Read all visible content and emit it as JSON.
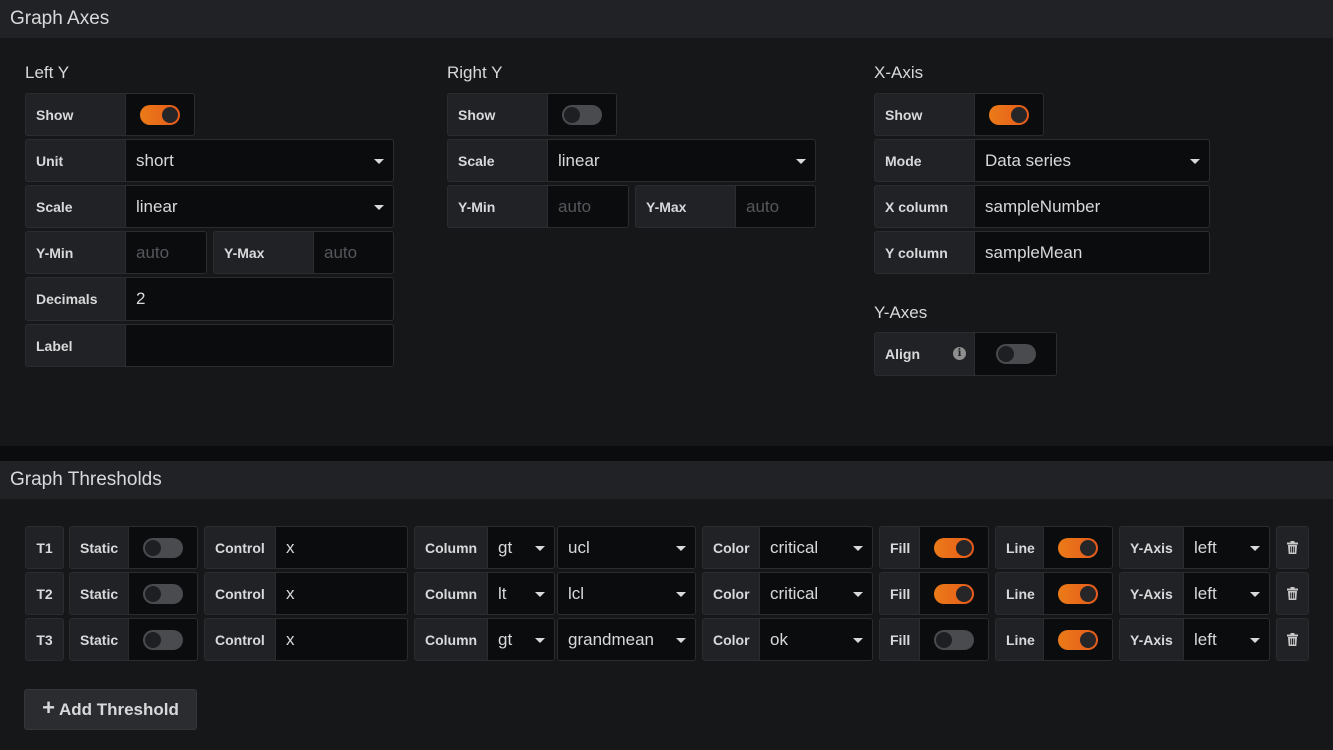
{
  "axes": {
    "title": "Graph Axes",
    "left_y": {
      "title": "Left Y",
      "show_label": "Show",
      "show": true,
      "unit_label": "Unit",
      "unit": "short",
      "scale_label": "Scale",
      "scale": "linear",
      "ymin_label": "Y-Min",
      "ymin_placeholder": "auto",
      "ymax_label": "Y-Max",
      "ymax_placeholder": "auto",
      "decimals_label": "Decimals",
      "decimals": "2",
      "label_label": "Label",
      "label": ""
    },
    "right_y": {
      "title": "Right Y",
      "show_label": "Show",
      "show": false,
      "scale_label": "Scale",
      "scale": "linear",
      "ymin_label": "Y-Min",
      "ymin_placeholder": "auto",
      "ymax_label": "Y-Max",
      "ymax_placeholder": "auto"
    },
    "x_axis": {
      "title": "X-Axis",
      "show_label": "Show",
      "show": true,
      "mode_label": "Mode",
      "mode": "Data series",
      "xcol_label": "X column",
      "xcol": "sampleNumber",
      "ycol_label": "Y column",
      "ycol": "sampleMean"
    },
    "y_axes": {
      "title": "Y-Axes",
      "align_label": "Align",
      "align": false,
      "info_icon": "info-icon"
    }
  },
  "thresholds": {
    "title": "Graph Thresholds",
    "labels": {
      "static": "Static",
      "control": "Control",
      "column": "Column",
      "color": "Color",
      "fill": "Fill",
      "line": "Line",
      "yaxis": "Y-Axis"
    },
    "rows": [
      {
        "id": "T1",
        "static": false,
        "control": "x",
        "op": "gt",
        "column": "ucl",
        "color": "critical",
        "fill": true,
        "line": true,
        "yaxis": "left"
      },
      {
        "id": "T2",
        "static": false,
        "control": "x",
        "op": "lt",
        "column": "lcl",
        "color": "critical",
        "fill": true,
        "line": true,
        "yaxis": "left"
      },
      {
        "id": "T3",
        "static": false,
        "control": "x",
        "op": "gt",
        "column": "grandmean",
        "color": "ok",
        "fill": false,
        "line": true,
        "yaxis": "left"
      }
    ],
    "add_label": "Add Threshold",
    "add_icon": "plus-icon",
    "delete_icon": "trash-icon"
  },
  "colors": {
    "accent_orange": "#eb7b18",
    "panel_bg": "#161719",
    "header_bg": "#212226",
    "input_bg": "#0b0c0e"
  }
}
